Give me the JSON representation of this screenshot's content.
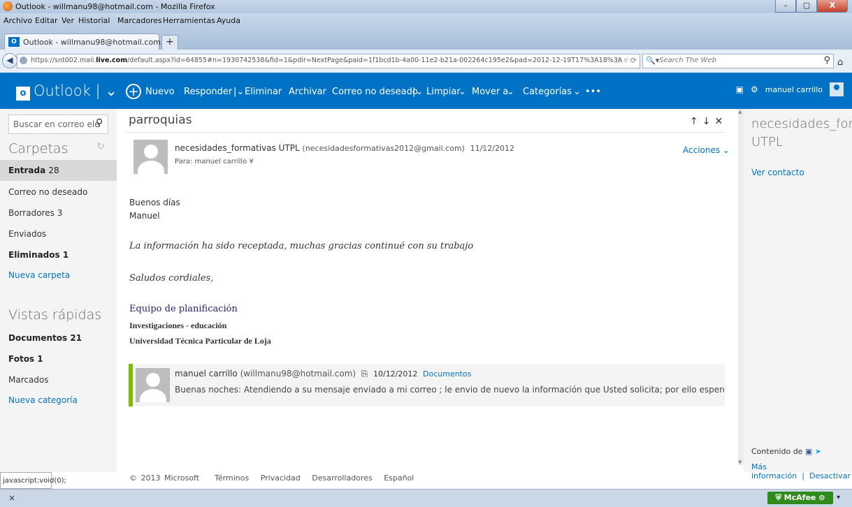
{
  "window": {
    "title": "Outlook - willmanu98@hotmail.com - Mozilla Firefox",
    "controls": [
      "–",
      "▢",
      "X"
    ]
  },
  "menubar": [
    "Archivo",
    "Editar",
    "Ver",
    "Historial",
    "Marcadores",
    "Herramientas",
    "Ayuda"
  ],
  "tab": {
    "label": "Outlook - willmanu98@hotmail.com",
    "icon": "outlook-icon"
  },
  "address": {
    "url_pre": "https://snt002.mail.",
    "url_bold": "live.com",
    "url_post": "/default.aspx?id=64855#n=1930742538&fid=1&pdir=NextPage&paid=1f1bcd1b-4a00-11e2-b21a-002264c195e2&pad=2012-12-19T17%3A18%3A",
    "search_placeholder": "Search The Web"
  },
  "outlook": {
    "brand": "Outlook",
    "toolbar": [
      "Nuevo",
      "Responder",
      "Eliminar",
      "Archivar",
      "Correo no deseado",
      "Limpiar",
      "Mover a",
      "Categorías",
      "•••"
    ],
    "user_name": "manuel carrillo",
    "accent": "#0072c6"
  },
  "left": {
    "search_placeholder": "Buscar en correo ele",
    "folders_header": "Carpetas",
    "folders": [
      {
        "label": "Entrada",
        "count": "28"
      },
      {
        "label": "Correo no deseado",
        "count": ""
      },
      {
        "label": "Borradores",
        "count": "3"
      },
      {
        "label": "Enviados",
        "count": ""
      },
      {
        "label": "Eliminados",
        "count": "1"
      }
    ],
    "new_folder": "Nueva carpeta",
    "quick_header": "Vistas rápidas",
    "quick": [
      {
        "label": "Documentos",
        "count": "21"
      },
      {
        "label": "Fotos",
        "count": "1"
      },
      {
        "label": "Marcados",
        "count": ""
      }
    ],
    "new_category": "Nueva categoría"
  },
  "message": {
    "subject": "parroquias",
    "sender_name": "necesidades_formativas UTPL",
    "sender_email": "(necesidadesformativas2012@gmail.com)",
    "date": "11/12/2012",
    "to": "Para: manuel carrillo",
    "actions": "Acciones",
    "greeting1": "Buenos días",
    "greeting2": "Manuel",
    "body": "La información ha sido receptada, muchas gracias continué con su trabajo",
    "closing": "Saludos cordiales,",
    "sig1": "Equipo de planificación",
    "sig2": "Investigaciones - educación",
    "sig3": "Universidad Técnica Particular de Loja"
  },
  "reply": {
    "sender_name": "manuel carrillo",
    "sender_email": "(willmanu98@hotmail.com)",
    "date": "10/12/2012",
    "category": "Documentos",
    "preview": "Buenas noches: Atendiendo a su mensaje enviado a mi correo ; le envio de nuevo la información que Usted solicita; por ello espero que cualquier..."
  },
  "footer": [
    "© 2013 Microsoft",
    "Términos",
    "Privacidad",
    "Desarrolladores",
    "Español"
  ],
  "right": {
    "contact_line1": "necesidades_for",
    "contact_line2": "UTPL",
    "view_contact": "Ver contacto",
    "content_from": "Contenido de",
    "more_info1": "Más",
    "more_info2": "información",
    "deactivate": "Desactivar"
  },
  "status": {
    "link": "javascript:void(0);",
    "close": "×",
    "mcafee": "McAfee"
  }
}
